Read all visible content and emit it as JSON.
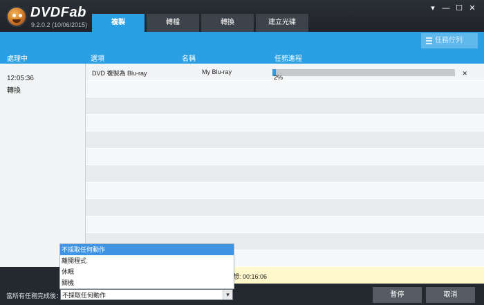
{
  "app": {
    "name": "DVDFab",
    "version": "9.2.0.2 (10/06/2015)"
  },
  "tabs": [
    {
      "label": "複製"
    },
    {
      "label": "轉檔"
    },
    {
      "label": "轉換"
    },
    {
      "label": "建立光碟"
    }
  ],
  "window_controls": {
    "dropdown": "▾",
    "minimize": "—",
    "maximize": "☐",
    "close": "✕"
  },
  "queue_button": {
    "label": "任務佇列"
  },
  "columns": {
    "processing": "處理中",
    "option": "選項",
    "name": "名稱",
    "progress": "任務進程"
  },
  "sidebar": {
    "time": "12:05:36",
    "status": "轉換"
  },
  "task": {
    "option": "DVD 複製為 Blu-ray",
    "name": "My Blu-ray",
    "progress_percent": 2,
    "progress_text": "2%"
  },
  "infobar": {
    "text": "想: 00:16:06"
  },
  "footer": {
    "after_label": "當所有任務完成後：",
    "selected": "不採取任何動作",
    "pause": "暫停",
    "cancel": "取消"
  },
  "dropdown_options": [
    "不採取任何動作",
    "離開程式",
    "休眠",
    "關機"
  ],
  "colors": {
    "accent": "#2b9fe3",
    "dark": "#24292f"
  }
}
